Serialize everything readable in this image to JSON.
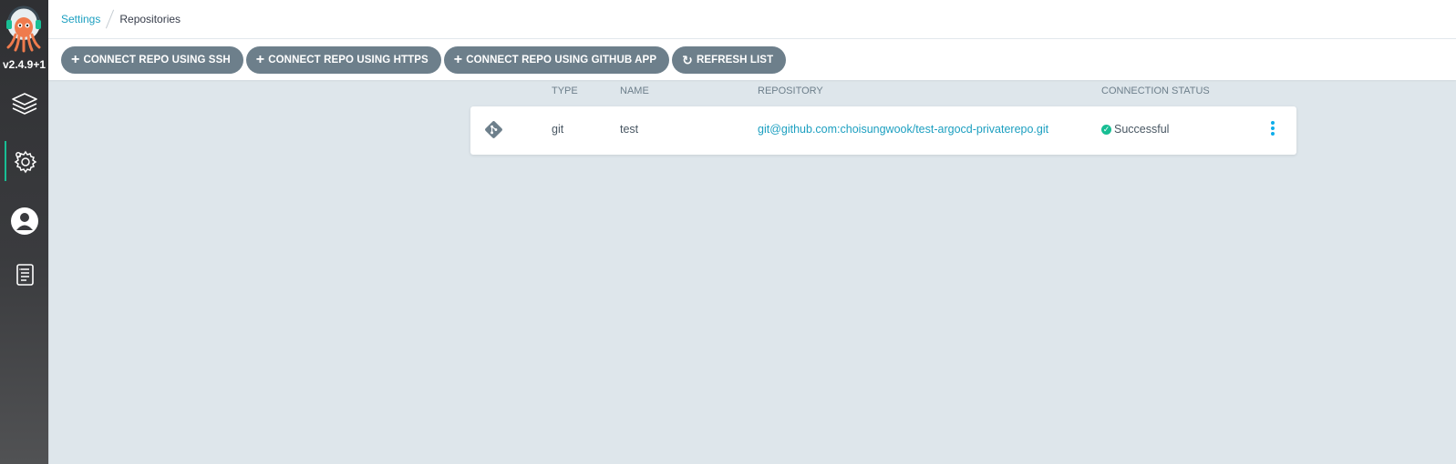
{
  "app": {
    "version": "v2.4.9+1"
  },
  "sidebar": {
    "items": [
      {
        "name": "applications",
        "icon": "layers-icon"
      },
      {
        "name": "settings",
        "icon": "gear-icon",
        "active": true
      },
      {
        "name": "user-info",
        "icon": "user-icon"
      },
      {
        "name": "documentation",
        "icon": "docs-icon"
      }
    ]
  },
  "breadcrumb": {
    "parent": "Settings",
    "current": "Repositories"
  },
  "toolbar": {
    "buttons": [
      {
        "label": "CONNECT REPO USING SSH",
        "icon": "plus-icon"
      },
      {
        "label": "CONNECT REPO USING HTTPS",
        "icon": "plus-icon"
      },
      {
        "label": "CONNECT REPO USING GITHUB APP",
        "icon": "plus-icon"
      },
      {
        "label": "REFRESH LIST",
        "icon": "refresh-icon"
      }
    ]
  },
  "table": {
    "headers": [
      "TYPE",
      "NAME",
      "REPOSITORY",
      "CONNECTION STATUS"
    ],
    "rows": [
      {
        "icon": "git-icon",
        "type": "git",
        "name": "test",
        "repository": "git@github.com:choisungwook/test-argocd-privaterepo.git",
        "status": "Successful",
        "status_icon": "check-circle-icon"
      }
    ]
  },
  "colors": {
    "accent": "#18be94",
    "link": "#1c9fc0",
    "button": "#6d7f8b",
    "background": "#dee6eb"
  }
}
